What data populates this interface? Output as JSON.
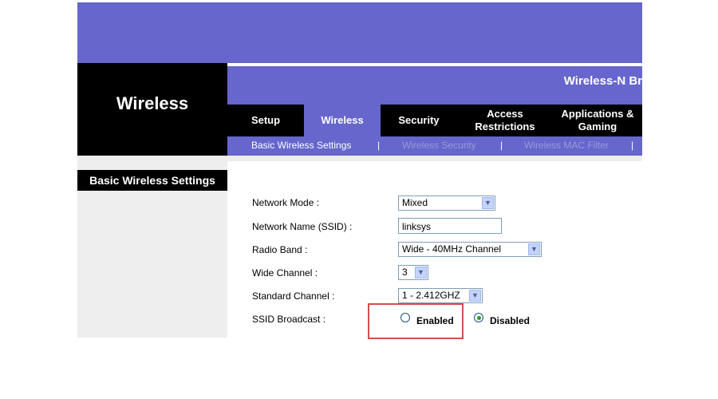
{
  "header": {
    "section_title": "Wireless",
    "product_name": "Wireless-N Br"
  },
  "tabs": [
    {
      "label": "Setup",
      "active": false
    },
    {
      "label": "Wireless",
      "active": true
    },
    {
      "label": "Security",
      "active": false
    },
    {
      "label": "Access Restrictions",
      "active": false
    },
    {
      "label": "Applications & Gaming",
      "active": false
    }
  ],
  "subnav": [
    {
      "label": "Basic Wireless Settings",
      "active": true
    },
    {
      "label": "|"
    },
    {
      "label": "Wireless Security",
      "active": false
    },
    {
      "label": "|"
    },
    {
      "label": "Wireless MAC Filter",
      "active": false
    },
    {
      "label": "|"
    }
  ],
  "sidebar": {
    "label": "Basic Wireless Settings"
  },
  "form": {
    "network_mode": {
      "label": "Network Mode :",
      "value": "Mixed"
    },
    "ssid": {
      "label": "Network Name (SSID) :",
      "value": "linksys"
    },
    "radio_band": {
      "label": "Radio Band :",
      "value": "Wide - 40MHz Channel"
    },
    "wide_channel": {
      "label": "Wide Channel :",
      "value": "3"
    },
    "standard_channel": {
      "label": "Standard Channel :",
      "value": "1 - 2.412GHZ"
    },
    "ssid_broadcast": {
      "label": "SSID Broadcast :",
      "options": [
        {
          "label": "Enabled",
          "selected": false
        },
        {
          "label": "Disabled",
          "selected": true
        }
      ]
    }
  },
  "colors": {
    "brand_purple": "#6666cc",
    "highlight_red": "#d94c4c",
    "radio_selected": "#21a121"
  },
  "icons": {
    "dropdown": "chevron-down-icon"
  }
}
